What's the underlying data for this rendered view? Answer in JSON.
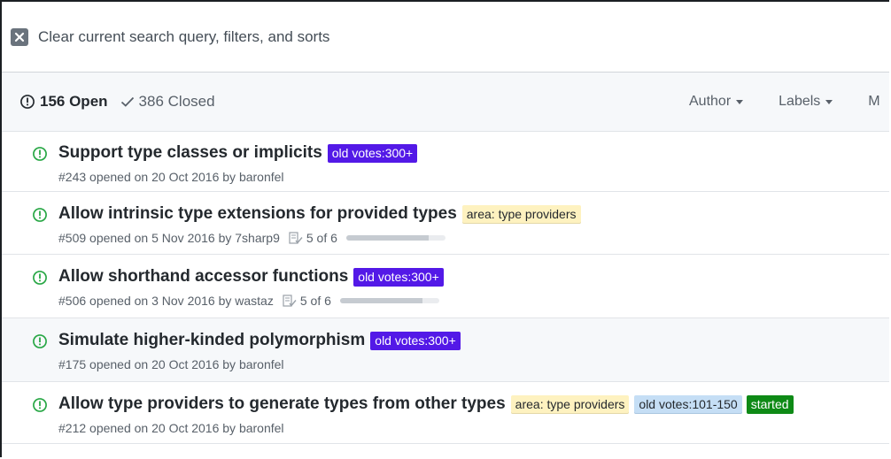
{
  "clear_bar": {
    "text": "Clear current search query, filters, and sorts"
  },
  "header": {
    "open_count": "156 Open",
    "closed_count": "386 Closed",
    "filters": [
      "Author",
      "Labels",
      "M"
    ]
  },
  "colors": {
    "open_green": "#28a745",
    "label_purple": "#5319e7",
    "label_yellow": "#fef2c0",
    "label_blue": "#c5def5",
    "label_green": "#0e8a16"
  },
  "issues": [
    {
      "title": "Support type classes or implicits",
      "labels": [
        "old votes:300+"
      ],
      "meta": "#243 opened on 20 Oct 2016 by baronfel"
    },
    {
      "title": "Allow intrinsic type extensions for provided types",
      "labels": [
        "area: type providers"
      ],
      "meta": "#509 opened on 5 Nov 2016 by 7sharp9",
      "tasks": "5 of 6",
      "progress": 0.83
    },
    {
      "title": "Allow shorthand accessor functions",
      "labels": [
        "old votes:300+"
      ],
      "meta": "#506 opened on 3 Nov 2016 by wastaz",
      "tasks": "5 of 6",
      "progress": 0.83
    },
    {
      "title": "Simulate higher-kinded polymorphism",
      "labels": [
        "old votes:300+"
      ],
      "meta": "#175 opened on 20 Oct 2016 by baronfel"
    },
    {
      "title": "Allow type providers to generate types from other types",
      "labels": [
        "area: type providers",
        "old votes:101-150",
        "started"
      ],
      "meta": "#212 opened on 20 Oct 2016 by baronfel"
    }
  ]
}
